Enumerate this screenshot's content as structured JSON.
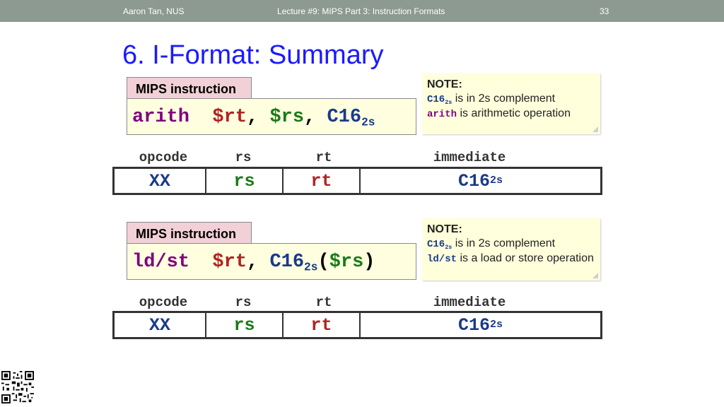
{
  "header": {
    "author": "Aaron Tan, NUS",
    "lecture": "Lecture #9: MIPS Part 3: Instruction Formats",
    "page": "33"
  },
  "title": "6. I-Format: Summary",
  "blocks": [
    {
      "tag": "MIPS instruction",
      "instruction": {
        "op": "arith",
        "rt": "$rt",
        "comma1": ",",
        "rs": "$rs",
        "comma2": ",",
        "imm": "C16",
        "imm_sub": "2s"
      },
      "note": {
        "heading": "NOTE:",
        "imm": "C16",
        "imm_sub": "2s",
        "imm_text": " is in 2s complement",
        "op": "arith",
        "op_text": " is arithmetic operation"
      },
      "format": {
        "labels": {
          "opcode": "opcode",
          "rs": "rs",
          "rt": "rt",
          "immediate": "immediate"
        },
        "cells": {
          "opcode": "XX",
          "rs": "rs",
          "rt": "rt",
          "imm": "C16",
          "imm_sub": "2s"
        }
      }
    },
    {
      "tag": "MIPS instruction",
      "instruction": {
        "op": "ld/st",
        "rt": "$rt",
        "comma1": ",",
        "imm": "C16",
        "imm_sub": "2s",
        "lparen": "(",
        "rs": "$rs",
        "rparen": ")"
      },
      "note": {
        "heading": "NOTE:",
        "imm": "C16",
        "imm_sub": "2s",
        "imm_text": " is in 2s complement",
        "op": "ld/st",
        "op_text": " is a load or store operation"
      },
      "format": {
        "labels": {
          "opcode": "opcode",
          "rs": "rs",
          "rt": "rt",
          "immediate": "immediate"
        },
        "cells": {
          "opcode": "XX",
          "rs": "rs",
          "rt": "rt",
          "imm": "C16",
          "imm_sub": "2s"
        }
      }
    }
  ],
  "colors": {
    "header_bg": "#8c9a92",
    "title": "#1a1aff",
    "tag_bg": "#f2d0d8",
    "instr_bg": "#ffffe0",
    "note_bg": "#ffffdc",
    "opcode": "#1a3a8a",
    "rs": "#1a7a1a",
    "rt": "#b22222",
    "arith": "#800080"
  },
  "icons": {
    "qr": "qr-code-icon"
  }
}
